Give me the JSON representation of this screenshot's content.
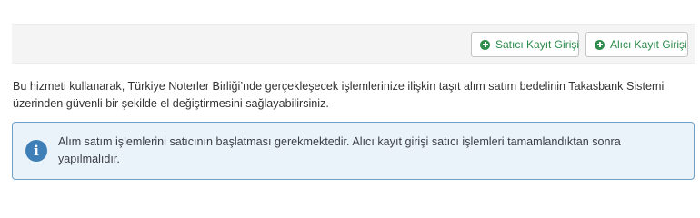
{
  "toolbar": {
    "seller_button": {
      "label": "Satıcı Kayıt Girişi",
      "icon": "plus-circle-icon"
    },
    "buyer_button": {
      "label": "Alıcı Kayıt Girişi",
      "icon": "plus-circle-icon"
    },
    "accent_color": "#2a8b4a"
  },
  "intro": {
    "text": "Bu hizmeti kullanarak, Türkiye Noterler Birliği’nde gerçekleşecek işlemlerinize ilişkin taşıt alım satım bedelinin Takasbank Sistemi üzerinden güvenli bir şekilde el değiştirmesini sağlayabilirsiniz."
  },
  "alert": {
    "icon": "info-icon",
    "icon_glyph": "i",
    "text": "Alım satım işlemlerini satıcının başlatması gerekmektedir. Alıcı kayıt girişi satıcı işlemleri tamamlandıktan sonra yapılmalıdır.",
    "border_color": "#6e9fc6",
    "background_color": "#eaf3fa"
  }
}
